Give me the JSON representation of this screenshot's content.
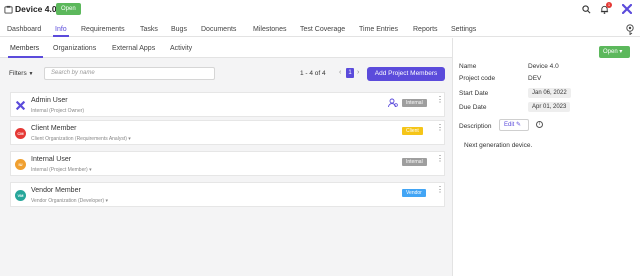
{
  "header": {
    "project_title": "Device 4.0",
    "status": "Open",
    "notification_count": "1"
  },
  "nav": {
    "tabs": [
      {
        "label": "Dashboard"
      },
      {
        "label": "Info"
      },
      {
        "label": "Requirements"
      },
      {
        "label": "Tasks"
      },
      {
        "label": "Bugs"
      },
      {
        "label": "Documents"
      },
      {
        "label": "Milestones"
      },
      {
        "label": "Test Coverage"
      },
      {
        "label": "Time Entries"
      },
      {
        "label": "Reports"
      },
      {
        "label": "Settings"
      }
    ],
    "active": "Info"
  },
  "subtabs": {
    "items": [
      {
        "label": "Members"
      },
      {
        "label": "Organizations"
      },
      {
        "label": "External Apps"
      },
      {
        "label": "Activity"
      }
    ],
    "active": "Members"
  },
  "toolbar": {
    "filters_label": "Filters",
    "search_placeholder": "Search by name",
    "pager_text": "1 - 4  of  4",
    "page": "1",
    "add_button": "Add Project Members"
  },
  "members": [
    {
      "initials": "X",
      "name": "Admin User",
      "sub": "Internal (Project Owner)",
      "badge": "Internal",
      "badge_color": "#9e9e9e",
      "avatar_color": "#5b4bdb"
    },
    {
      "initials": "CM",
      "name": "Client Member",
      "sub": "Client Organization (Requirements Analyst) ▾",
      "badge": "Client",
      "badge_color": "#f5c518",
      "avatar_color": "#e53935"
    },
    {
      "initials": "IU",
      "name": "Internal User",
      "sub": "Internal (Project Member) ▾",
      "badge": "Internal",
      "badge_color": "#9e9e9e",
      "avatar_color": "#f0a030"
    },
    {
      "initials": "VM",
      "name": "Vendor Member",
      "sub": "Vendor Organization (Developer) ▾",
      "badge": "Vendor",
      "badge_color": "#42a5f5",
      "avatar_color": "#26a69a"
    }
  ],
  "details": {
    "status_button": "Open ▾",
    "name_label": "Name",
    "name_value": "Device 4.0",
    "code_label": "Project code",
    "code_value": "DEV",
    "start_label": "Start Date",
    "start_value": "Jan 06, 2022",
    "due_label": "Due Date",
    "due_value": "Apr 01, 2023",
    "description_label": "Description",
    "edit_label": "Edit ✎",
    "description_text": "Next generation device."
  }
}
